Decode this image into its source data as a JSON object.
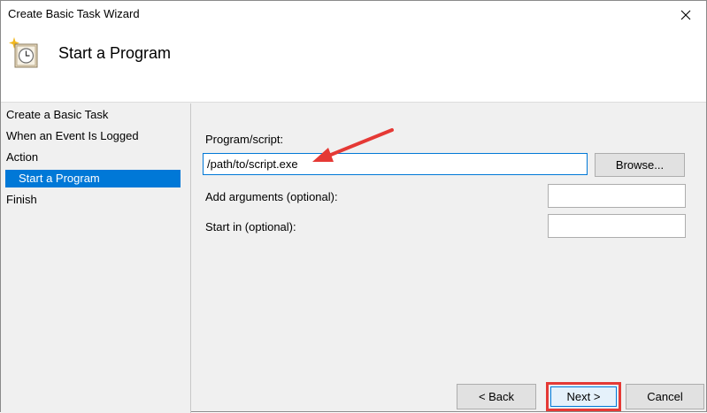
{
  "window": {
    "title": "Create Basic Task Wizard"
  },
  "header": {
    "title": "Start a Program",
    "icon": "task-scheduler-clock-icon"
  },
  "sidebar": {
    "items": [
      {
        "label": "Create a Basic Task",
        "selected": false,
        "indent": false
      },
      {
        "label": "When an Event Is Logged",
        "selected": false,
        "indent": false
      },
      {
        "label": "Action",
        "selected": false,
        "indent": false
      },
      {
        "label": "Start a Program",
        "selected": true,
        "indent": true
      },
      {
        "label": "Finish",
        "selected": false,
        "indent": false
      }
    ]
  },
  "form": {
    "program_label": "Program/script:",
    "program_value": "/path/to/script.exe",
    "browse_label": "Browse...",
    "arguments_label": "Add arguments (optional):",
    "arguments_value": "",
    "startin_label": "Start in (optional):",
    "startin_value": ""
  },
  "footer": {
    "back_label": "< Back",
    "next_label": "Next >",
    "cancel_label": "Cancel"
  },
  "colors": {
    "selection": "#0078d7",
    "annotation": "#e53935"
  }
}
